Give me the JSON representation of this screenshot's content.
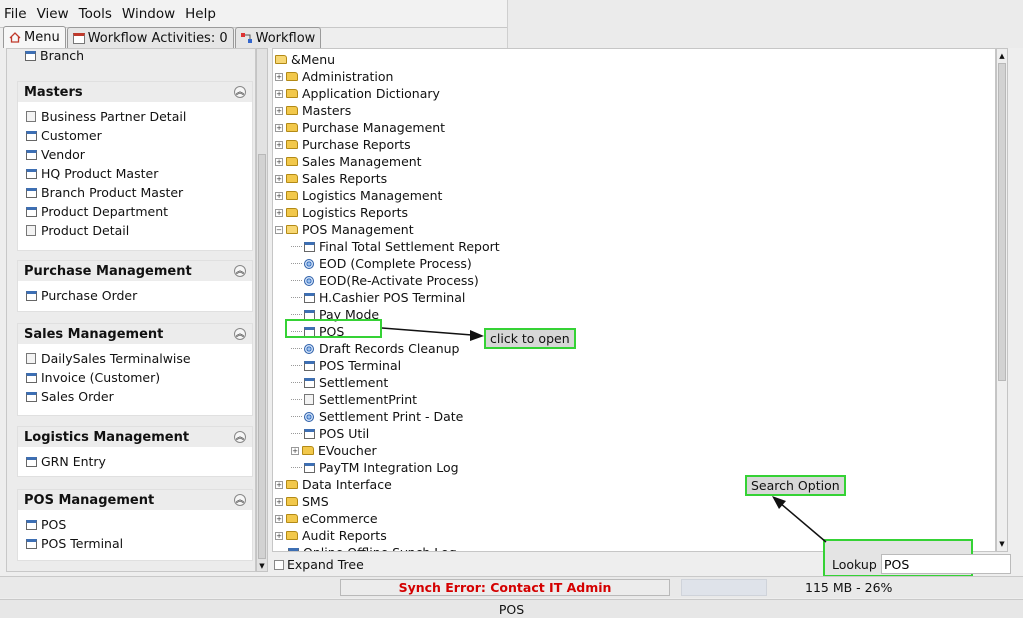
{
  "menubar": {
    "items": [
      "File",
      "View",
      "Tools",
      "Window",
      "Help"
    ]
  },
  "tabs": [
    {
      "label": "Menu",
      "icon": "home-icon"
    },
    {
      "label": "Workflow Activities: 0",
      "icon": "calendar-icon"
    },
    {
      "label": "Workflow",
      "icon": "workflow-icon"
    }
  ],
  "left": {
    "partial_item": "Branch",
    "groups": [
      {
        "title": "Masters",
        "items": [
          {
            "label": "Business Partner Detail",
            "icon": "doc"
          },
          {
            "label": "Customer",
            "icon": "win"
          },
          {
            "label": "Vendor",
            "icon": "win"
          },
          {
            "label": "HQ Product Master",
            "icon": "win"
          },
          {
            "label": "Branch Product Master",
            "icon": "win"
          },
          {
            "label": "Product Department",
            "icon": "win"
          },
          {
            "label": "Product Detail",
            "icon": "doc"
          }
        ]
      },
      {
        "title": "Purchase Management",
        "items": [
          {
            "label": "Purchase Order",
            "icon": "win"
          }
        ]
      },
      {
        "title": "Sales Management",
        "items": [
          {
            "label": "DailySales Terminalwise",
            "icon": "doc"
          },
          {
            "label": "Invoice (Customer)",
            "icon": "win"
          },
          {
            "label": "Sales Order",
            "icon": "win"
          }
        ]
      },
      {
        "title": "Logistics Management",
        "items": [
          {
            "label": "GRN Entry",
            "icon": "win"
          }
        ]
      },
      {
        "title": "POS Management",
        "items": [
          {
            "label": "POS",
            "icon": "win"
          },
          {
            "label": "POS Terminal",
            "icon": "win"
          }
        ]
      }
    ]
  },
  "tree": {
    "root": "&Menu",
    "rows": [
      {
        "label": "Administration",
        "type": "folder",
        "level": 1
      },
      {
        "label": "Application Dictionary",
        "type": "folder",
        "level": 1
      },
      {
        "label": "Masters",
        "type": "folder",
        "level": 1
      },
      {
        "label": "Purchase Management",
        "type": "folder",
        "level": 1
      },
      {
        "label": "Purchase Reports",
        "type": "folder",
        "level": 1
      },
      {
        "label": "Sales Management",
        "type": "folder",
        "level": 1
      },
      {
        "label": "Sales Reports",
        "type": "folder",
        "level": 1
      },
      {
        "label": "Logistics Management",
        "type": "folder",
        "level": 1
      },
      {
        "label": "Logistics Reports",
        "type": "folder",
        "level": 1
      },
      {
        "label": "POS Management",
        "type": "open-folder",
        "level": 1
      },
      {
        "label": "Final Total Settlement Report",
        "type": "win",
        "level": 2
      },
      {
        "label": "EOD (Complete Process)",
        "type": "proc",
        "level": 2
      },
      {
        "label": "EOD(Re-Activate Process)",
        "type": "proc",
        "level": 2
      },
      {
        "label": "H.Cashier POS Terminal",
        "type": "win",
        "level": 2
      },
      {
        "label": "Pay Mode",
        "type": "win",
        "level": 2
      },
      {
        "label": "POS",
        "type": "win",
        "level": 2
      },
      {
        "label": "Draft Records Cleanup",
        "type": "proc",
        "level": 2
      },
      {
        "label": "POS Terminal",
        "type": "win",
        "level": 2
      },
      {
        "label": "Settlement",
        "type": "win",
        "level": 2
      },
      {
        "label": "SettlementPrint",
        "type": "doc",
        "level": 2
      },
      {
        "label": "Settlement Print - Date",
        "type": "proc",
        "level": 2
      },
      {
        "label": "POS Util",
        "type": "win",
        "level": 2
      },
      {
        "label": "EVoucher",
        "type": "folder",
        "level": 2
      },
      {
        "label": "PayTM Integration Log",
        "type": "win",
        "level": 2
      },
      {
        "label": "Data Interface",
        "type": "folder",
        "level": 1
      },
      {
        "label": "SMS",
        "type": "folder",
        "level": 1
      },
      {
        "label": "eCommerce",
        "type": "folder",
        "level": 1
      },
      {
        "label": "Audit Reports",
        "type": "folder",
        "level": 1
      },
      {
        "label": "Online Offline Synch Log",
        "type": "win",
        "level": 1
      }
    ]
  },
  "bottom": {
    "expand_tree": "Expand Tree",
    "lookup_label": "Lookup",
    "lookup_value": "POS"
  },
  "status": {
    "error": "Synch Error: Contact IT Admin",
    "memory": "115 MB - 26%",
    "last": "POS"
  },
  "annotations": {
    "click_to_open": "click to open",
    "search_option": "Search Option"
  },
  "colors": {
    "error": "#d40000",
    "highlight": "#35d235"
  }
}
